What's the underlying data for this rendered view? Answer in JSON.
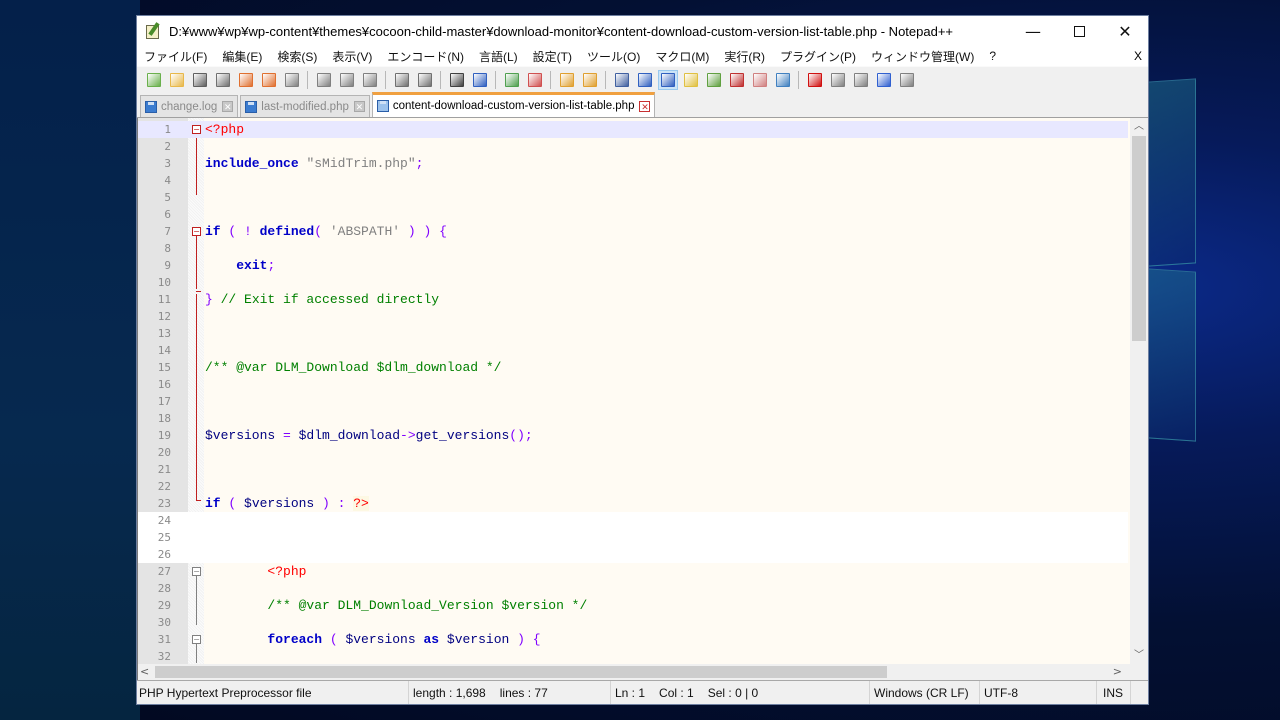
{
  "window": {
    "title": "D:¥www¥wp¥wp-content¥themes¥cocoon-child-master¥download-monitor¥content-download-custom-version-list-table.php - Notepad++",
    "minimize_label": "—",
    "close_label": "✕"
  },
  "menu": {
    "items": [
      "ファイル(F)",
      "編集(E)",
      "検索(S)",
      "表示(V)",
      "エンコード(N)",
      "言語(L)",
      "設定(T)",
      "ツール(O)",
      "マクロ(M)",
      "実行(R)",
      "プラグイン(P)",
      "ウィンドウ管理(W)",
      "?"
    ],
    "close_doc_label": "X"
  },
  "toolbar": {
    "buttons": [
      {
        "icon": "new-file-icon",
        "color": "#6ab04c"
      },
      {
        "icon": "open-file-icon",
        "color": "#e8b84a"
      },
      {
        "icon": "save-icon",
        "color": "#606060"
      },
      {
        "icon": "save-all-icon",
        "color": "#707070"
      },
      {
        "icon": "close-icon",
        "color": "#e07030"
      },
      {
        "icon": "close-all-icon",
        "color": "#e07030"
      },
      {
        "icon": "print-icon",
        "color": "#808080"
      },
      {
        "sep": true
      },
      {
        "icon": "cut-icon",
        "color": "#808080"
      },
      {
        "icon": "copy-icon",
        "color": "#808080"
      },
      {
        "icon": "paste-icon",
        "color": "#808080"
      },
      {
        "sep": true
      },
      {
        "icon": "undo-icon",
        "color": "#707070"
      },
      {
        "icon": "redo-icon",
        "color": "#707070"
      },
      {
        "sep": true
      },
      {
        "icon": "find-icon",
        "color": "#404040"
      },
      {
        "icon": "replace-icon",
        "color": "#3060c0"
      },
      {
        "sep": true
      },
      {
        "icon": "zoom-in-icon",
        "color": "#50a050"
      },
      {
        "icon": "zoom-out-icon",
        "color": "#d05050"
      },
      {
        "sep": true
      },
      {
        "icon": "sync-vertical-icon",
        "color": "#e0a030"
      },
      {
        "icon": "sync-horizontal-icon",
        "color": "#e0a030"
      },
      {
        "sep": true
      },
      {
        "icon": "word-wrap-icon",
        "color": "#4060a0"
      },
      {
        "icon": "show-all-chars-icon",
        "color": "#3060c0"
      },
      {
        "icon": "indent-guide-icon",
        "color": "#3060c0",
        "active": true
      },
      {
        "icon": "language-icon",
        "color": "#e0c040"
      },
      {
        "icon": "doc-map-icon",
        "color": "#60a040"
      },
      {
        "icon": "function-list-icon",
        "color": "#c03030"
      },
      {
        "icon": "folder-workspace-icon",
        "color": "#d08080"
      },
      {
        "icon": "monitoring-icon",
        "color": "#4080c0"
      },
      {
        "sep": true
      },
      {
        "icon": "record-macro-icon",
        "color": "#d01010"
      },
      {
        "icon": "stop-record-icon",
        "color": "#808080"
      },
      {
        "icon": "play-macro-icon",
        "color": "#808080"
      },
      {
        "icon": "run-macro-multiple-icon",
        "color": "#3060d0"
      },
      {
        "icon": "save-macro-icon",
        "color": "#808080"
      }
    ]
  },
  "tabs": [
    {
      "label": "change.log",
      "active": false
    },
    {
      "label": "last-modified.php",
      "active": false
    },
    {
      "label": "content-download-custom-version-list-table.php",
      "active": true
    }
  ],
  "editor": {
    "lines": [
      {
        "n": "1",
        "tokens": [
          {
            "t": "<?php",
            "c": "ph"
          }
        ],
        "fold": "minus",
        "current": true
      },
      {
        "n": "2",
        "tokens": []
      },
      {
        "n": "3",
        "tokens": [
          {
            "t": "include_once",
            "c": "k"
          },
          {
            "t": " ",
            "c": "d"
          },
          {
            "t": "\"sMidTrim.php\"",
            "c": "s"
          },
          {
            "t": ";",
            "c": "o"
          }
        ]
      },
      {
        "n": "4",
        "tokens": []
      },
      {
        "n": "5",
        "tokens": []
      },
      {
        "n": "6",
        "tokens": []
      },
      {
        "n": "7",
        "tokens": [
          {
            "t": "if",
            "c": "k"
          },
          {
            "t": " ( ! ",
            "c": "o"
          },
          {
            "t": "defined",
            "c": "k"
          },
          {
            "t": "( ",
            "c": "o"
          },
          {
            "t": "'ABSPATH'",
            "c": "s"
          },
          {
            "t": " ) ) {",
            "c": "o"
          }
        ],
        "fold": "minus"
      },
      {
        "n": "8",
        "tokens": []
      },
      {
        "n": "9",
        "tokens": [
          {
            "t": "    ",
            "c": "d"
          },
          {
            "t": "exit",
            "c": "k"
          },
          {
            "t": ";",
            "c": "o"
          }
        ]
      },
      {
        "n": "10",
        "tokens": []
      },
      {
        "n": "11",
        "tokens": [
          {
            "t": "}",
            "c": "o"
          },
          {
            "t": " // Exit if accessed directly",
            "c": "c"
          }
        ],
        "fold": "end"
      },
      {
        "n": "12",
        "tokens": []
      },
      {
        "n": "13",
        "tokens": []
      },
      {
        "n": "14",
        "tokens": []
      },
      {
        "n": "15",
        "tokens": [
          {
            "t": "/** @var DLM_Download $dlm_download */",
            "c": "c"
          }
        ]
      },
      {
        "n": "16",
        "tokens": []
      },
      {
        "n": "17",
        "tokens": []
      },
      {
        "n": "18",
        "tokens": []
      },
      {
        "n": "19",
        "tokens": [
          {
            "t": "$versions",
            "c": "v"
          },
          {
            "t": " = ",
            "c": "o"
          },
          {
            "t": "$dlm_download",
            "c": "v"
          },
          {
            "t": "->",
            "c": "o"
          },
          {
            "t": "get_versions",
            "c": "v"
          },
          {
            "t": "();",
            "c": "o"
          }
        ]
      },
      {
        "n": "20",
        "tokens": []
      },
      {
        "n": "21",
        "tokens": []
      },
      {
        "n": "22",
        "tokens": []
      },
      {
        "n": "23",
        "tokens": [
          {
            "t": "if",
            "c": "k"
          },
          {
            "t": " ( ",
            "c": "o"
          },
          {
            "t": "$versions",
            "c": "v"
          },
          {
            "t": " ) : ",
            "c": "o"
          },
          {
            "t": "?>",
            "c": "phb"
          }
        ],
        "fold": "end"
      },
      {
        "n": "24",
        "tokens": [],
        "white": true
      },
      {
        "n": "25",
        "tokens": [],
        "white": true
      },
      {
        "n": "26",
        "tokens": [],
        "white": true
      },
      {
        "n": "27",
        "tokens": [
          {
            "t": "        ",
            "c": "d"
          },
          {
            "t": "<?php",
            "c": "ph"
          }
        ],
        "fold": "minus-gray"
      },
      {
        "n": "28",
        "tokens": []
      },
      {
        "n": "29",
        "tokens": [
          {
            "t": "        ",
            "c": "d"
          },
          {
            "t": "/** @var DLM_Download_Version $version */",
            "c": "c"
          }
        ]
      },
      {
        "n": "30",
        "tokens": []
      },
      {
        "n": "31",
        "tokens": [
          {
            "t": "        ",
            "c": "d"
          },
          {
            "t": "foreach",
            "c": "k"
          },
          {
            "t": " ( ",
            "c": "o"
          },
          {
            "t": "$versions",
            "c": "v"
          },
          {
            "t": " ",
            "c": "d"
          },
          {
            "t": "as",
            "c": "k"
          },
          {
            "t": " ",
            "c": "d"
          },
          {
            "t": "$version",
            "c": "v"
          },
          {
            "t": " ) {",
            "c": "o"
          }
        ],
        "fold": "minus-gray"
      },
      {
        "n": "32",
        "tokens": []
      }
    ]
  },
  "statusbar": {
    "file_type": "PHP Hypertext Preprocessor file",
    "length": "length : 1,698",
    "lines": "lines : 77",
    "ln": "Ln : 1",
    "col": "Col : 1",
    "sel": "Sel : 0 | 0",
    "eol": "Windows (CR LF)",
    "encoding": "UTF-8",
    "mode": "INS"
  }
}
